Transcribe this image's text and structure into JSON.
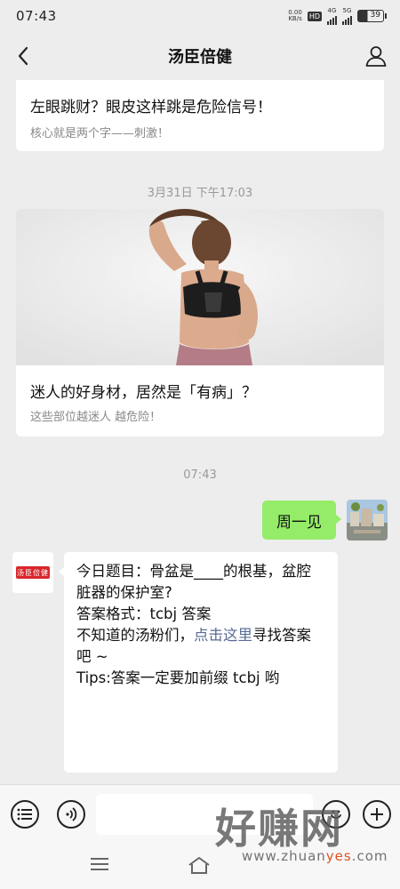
{
  "status_bar": {
    "time": "07:43",
    "net_speed": "0.00",
    "net_unit": "KB/s",
    "hd_label": "HD",
    "sig1": "4G",
    "sig2": "5G",
    "battery": "39"
  },
  "header": {
    "title": "汤臣倍健"
  },
  "messages": {
    "article1": {
      "title": "左眼跳财？眼皮这样跳是危险信号！",
      "subtitle": "核心就是两个字——刺激！"
    },
    "timestamp1": "3月31日 下午17:03",
    "article2": {
      "title": "迷人的好身材，居然是「有病」？",
      "subtitle": "这些部位越迷人 越危险！"
    },
    "timestamp2": "07:43",
    "sent": {
      "text": "周一见"
    },
    "received": {
      "avatar_logo": "汤臣倍健",
      "line1": "今日题目：骨盆是____的根基，盆腔脏器的保护室?",
      "line2": "答案格式：tcbj 答案",
      "line3_prefix": "不知道的汤粉们，",
      "line3_link": "点击这里",
      "line3_suffix": "寻找答案吧 ~",
      "line4": "Tips:答案一定要加前缀 tcbj 哟"
    }
  },
  "input_bar": {
    "placeholder": ""
  },
  "watermark": {
    "big": "好赚网",
    "small_prefix": "www.zhuan",
    "small_accent": "yes",
    "small_suffix": ".com"
  },
  "colors": {
    "background": "#ededed",
    "sent_bubble": "#95ec69",
    "link": "#576b95",
    "brand_red": "#d8262b"
  }
}
